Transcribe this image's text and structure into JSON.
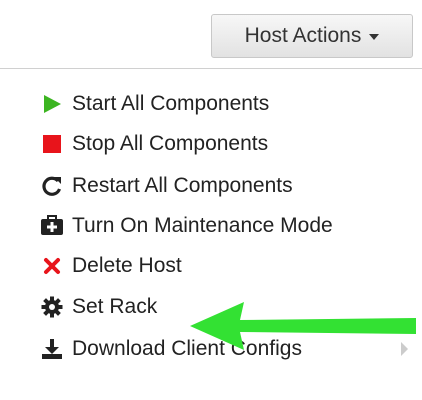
{
  "toolbar": {
    "host_actions_label": "Host Actions"
  },
  "menu": {
    "items": [
      {
        "label": "Start All Components",
        "icon": "play-icon",
        "icon_color": "#3cb521"
      },
      {
        "label": "Stop All Components",
        "icon": "stop-icon",
        "icon_color": "#e8141b"
      },
      {
        "label": "Restart All Components",
        "icon": "refresh-icon",
        "icon_color": "#222222"
      },
      {
        "label": "Turn On Maintenance Mode",
        "icon": "medkit-icon",
        "icon_color": "#222222"
      },
      {
        "label": "Delete Host",
        "icon": "close-icon",
        "icon_color": "#e8141b"
      },
      {
        "label": "Set Rack",
        "icon": "gear-icon",
        "icon_color": "#222222"
      },
      {
        "label": "Download Client Configs",
        "icon": "download-icon",
        "icon_color": "#222222"
      }
    ]
  },
  "annotation": {
    "arrow_color": "#33e133",
    "points_to": "Set Rack"
  }
}
